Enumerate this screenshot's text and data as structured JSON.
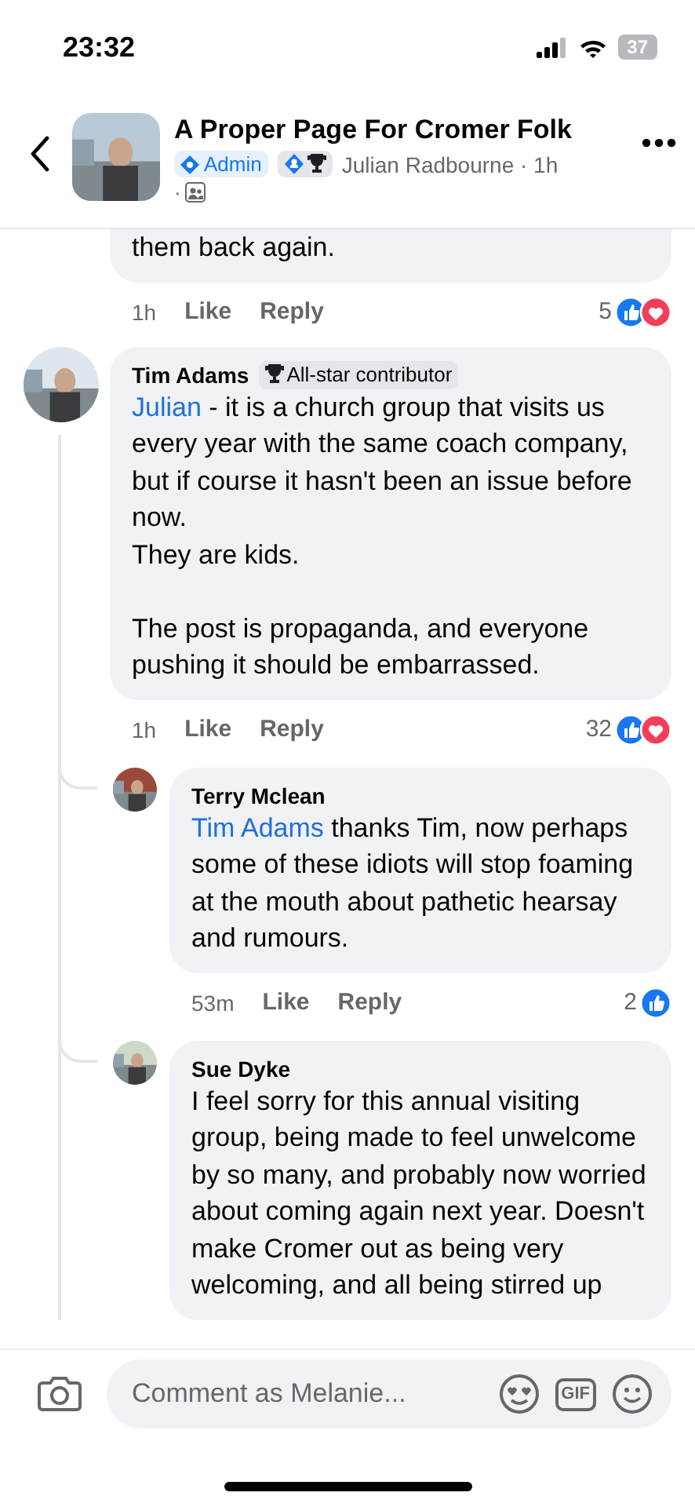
{
  "status_bar": {
    "time": "23:32",
    "battery": "37"
  },
  "header": {
    "title": "A Proper Page For Cromer Folk",
    "badges": [
      {
        "kind": "admin",
        "label": "Admin"
      },
      {
        "kind": "roles"
      }
    ],
    "author": "Julian Radbourne · 1h",
    "tail": "·"
  },
  "comments": [
    {
      "kind": "fragment",
      "paragraphs": [
        {
          "text": "them back again."
        }
      ],
      "time": "1h",
      "like": "Like",
      "reply": "Reply",
      "reaction_count": "5",
      "reactions": [
        {
          "kind": "like"
        },
        {
          "kind": "love"
        }
      ]
    },
    {
      "kind": "full",
      "name": "Tim Adams",
      "badge": "All-star contributor",
      "paragraphs": [
        {
          "mention": "Julian",
          "text": " - it is a church group that visits us every year with the same coach company, but if course it hasn't been an issue before now."
        },
        {
          "text": "They are kids."
        },
        {
          "text": "The post is propaganda, and everyone pushing it should be embarrassed.",
          "gap_before": true
        }
      ],
      "time": "1h",
      "like": "Like",
      "reply": "Reply",
      "reaction_count": "32",
      "reactions": [
        {
          "kind": "like"
        },
        {
          "kind": "love"
        }
      ],
      "replies": [
        {
          "kind": "full",
          "name": "Terry Mclean",
          "paragraphs": [
            {
              "mention": "Tim Adams",
              "text": " thanks Tim, now perhaps some of these idiots will stop foaming at the mouth about pathetic hearsay and rumours."
            }
          ],
          "time": "53m",
          "like": "Like",
          "reply": "Reply",
          "reaction_count": "2",
          "reactions": [
            {
              "kind": "like"
            }
          ]
        },
        {
          "kind": "full",
          "name": "Sue Dyke",
          "paragraphs": [
            {
              "text": "I feel sorry for this annual visiting group, being made to feel unwelcome by so many, and probably now worried about coming again next year. Doesn't make Cromer out as being very welcoming, and all being stirred up"
            }
          ]
        }
      ]
    }
  ],
  "composer": {
    "placeholder": "Comment as Melanie...",
    "gif_label": "GIF"
  }
}
